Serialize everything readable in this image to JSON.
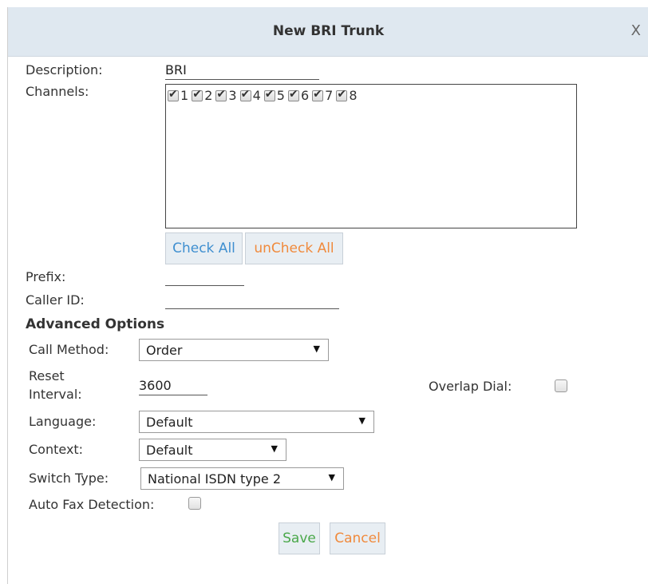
{
  "dialog": {
    "title": "New BRI Trunk",
    "close": "X"
  },
  "form": {
    "description": {
      "label": "Description:",
      "value": "BRI"
    },
    "channels": {
      "label": "Channels:",
      "items": [
        "1",
        "2",
        "3",
        "4",
        "5",
        "6",
        "7",
        "8"
      ],
      "check_all": "Check All",
      "uncheck_all": "unCheck All"
    },
    "prefix": {
      "label": "Prefix:",
      "value": ""
    },
    "caller_id": {
      "label": "Caller ID:",
      "value": ""
    }
  },
  "advanced": {
    "heading": "Advanced Options",
    "call_method": {
      "label": "Call Method:",
      "value": "Order"
    },
    "reset_interval": {
      "label_line1": "Reset",
      "label_line2": "Interval:",
      "value": "3600"
    },
    "overlap_dial": {
      "label": "Overlap Dial:",
      "checked": false
    },
    "language": {
      "label": "Language:",
      "value": "Default"
    },
    "context": {
      "label": "Context:",
      "value": "Default"
    },
    "switch_type": {
      "label": "Switch Type:",
      "value": "National ISDN type 2"
    },
    "auto_fax": {
      "label": "Auto Fax Detection:",
      "checked": false
    }
  },
  "actions": {
    "save": "Save",
    "cancel": "Cancel"
  },
  "colors": {
    "title_bar": "#dfe8f0",
    "accent_blue": "#3f8fd0",
    "accent_orange": "#f08a3c",
    "accent_green": "#4aa84a"
  }
}
